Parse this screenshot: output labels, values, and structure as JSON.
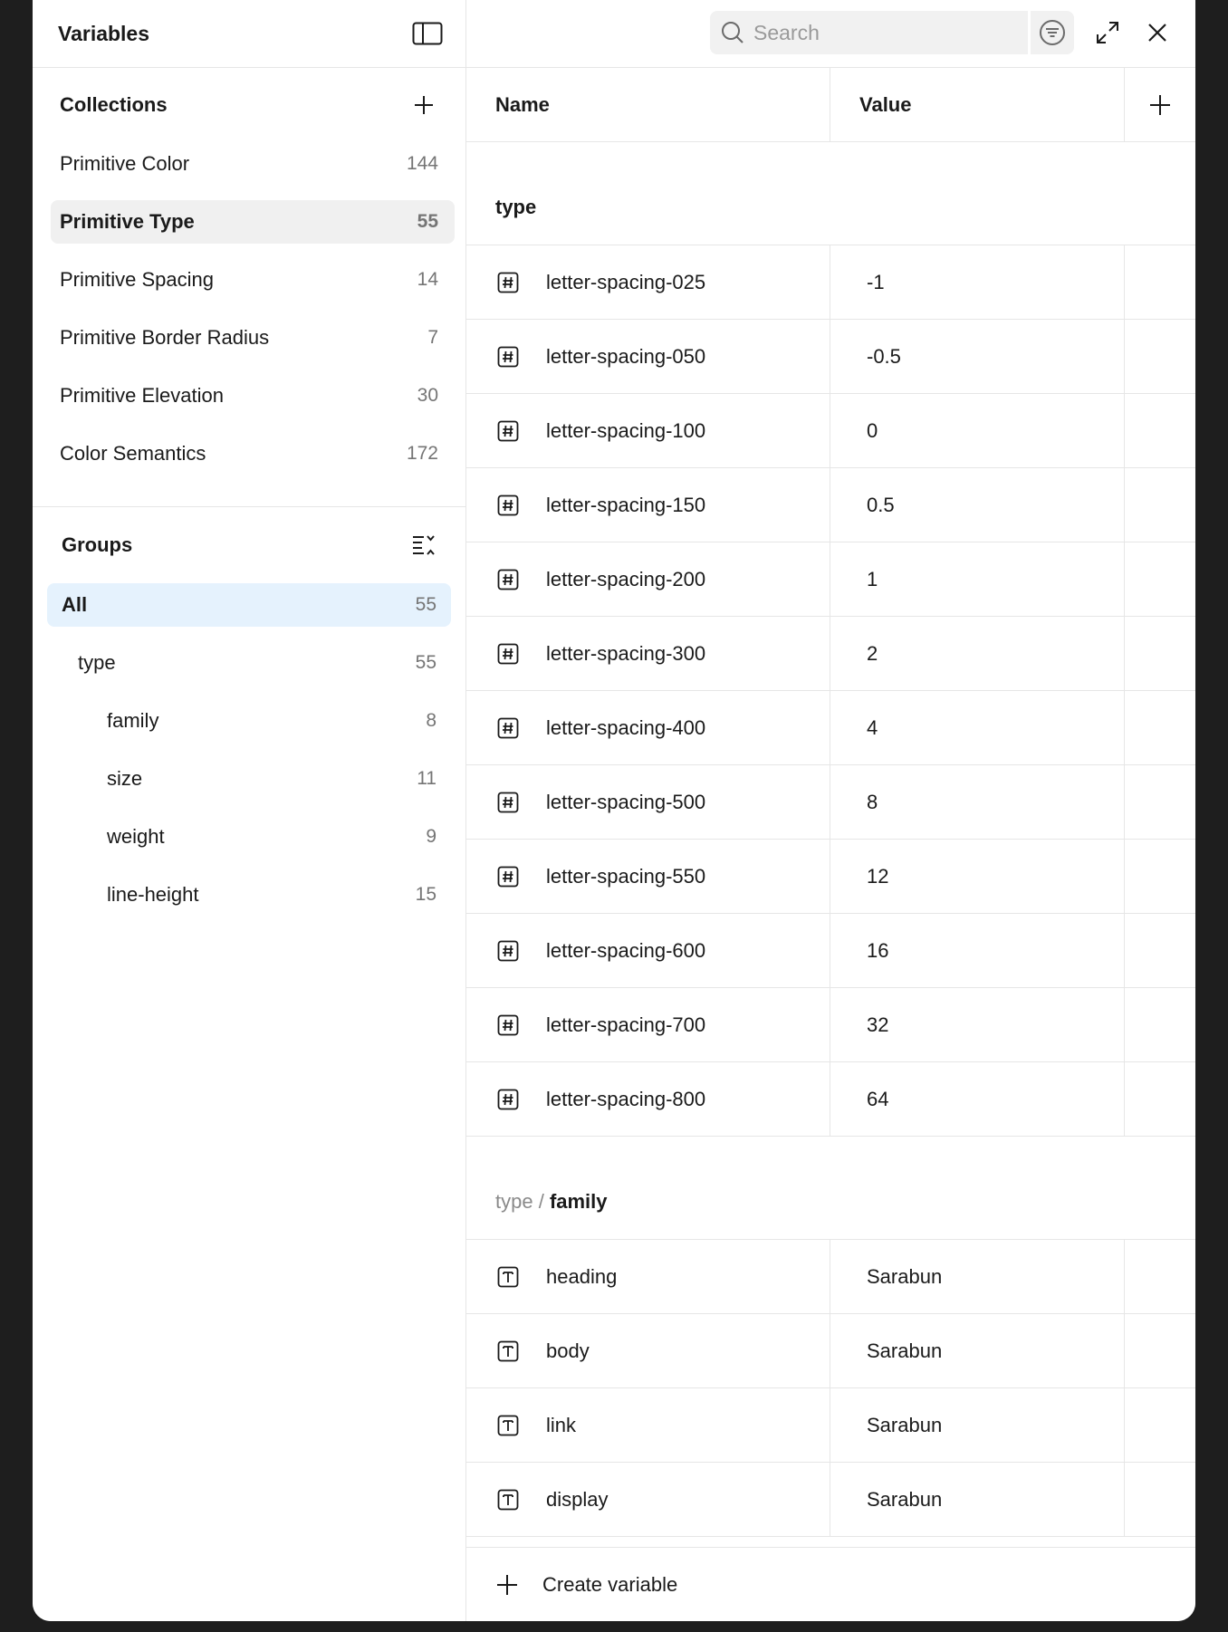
{
  "left": {
    "title": "Variables",
    "collections_label": "Collections",
    "collections": [
      {
        "label": "Primitive Color",
        "count": "144"
      },
      {
        "label": "Primitive Type",
        "count": "55"
      },
      {
        "label": "Primitive Spacing",
        "count": "14"
      },
      {
        "label": "Primitive Border Radius",
        "count": "7"
      },
      {
        "label": "Primitive Elevation",
        "count": "30"
      },
      {
        "label": "Color Semantics",
        "count": "172"
      }
    ],
    "groups_label": "Groups",
    "groups": [
      {
        "label": "All",
        "count": "55"
      },
      {
        "label": "type",
        "count": "55"
      },
      {
        "label": "family",
        "count": "8"
      },
      {
        "label": "size",
        "count": "11"
      },
      {
        "label": "weight",
        "count": "9"
      },
      {
        "label": "line-height",
        "count": "15"
      }
    ]
  },
  "topbar": {
    "search_placeholder": "Search"
  },
  "table": {
    "name_header": "Name",
    "value_header": "Value",
    "group1": {
      "title": "type"
    },
    "group1_rows": [
      {
        "name": "letter-spacing-025",
        "value": "-1"
      },
      {
        "name": "letter-spacing-050",
        "value": "-0.5"
      },
      {
        "name": "letter-spacing-100",
        "value": "0"
      },
      {
        "name": "letter-spacing-150",
        "value": "0.5"
      },
      {
        "name": "letter-spacing-200",
        "value": "1"
      },
      {
        "name": "letter-spacing-300",
        "value": "2"
      },
      {
        "name": "letter-spacing-400",
        "value": "4"
      },
      {
        "name": "letter-spacing-500",
        "value": "8"
      },
      {
        "name": "letter-spacing-550",
        "value": "12"
      },
      {
        "name": "letter-spacing-600",
        "value": "16"
      },
      {
        "name": "letter-spacing-700",
        "value": "32"
      },
      {
        "name": "letter-spacing-800",
        "value": "64"
      }
    ],
    "group2": {
      "path": "type /",
      "title": "family"
    },
    "group2_rows": [
      {
        "name": "heading",
        "value": "Sarabun"
      },
      {
        "name": "body",
        "value": "Sarabun"
      },
      {
        "name": "link",
        "value": "Sarabun"
      },
      {
        "name": "display",
        "value": "Sarabun"
      }
    ]
  },
  "footer": {
    "create_label": "Create variable"
  },
  "colors": {
    "selected_collection_bg": "#f0f0f0",
    "active_group_bg": "#e5f2fd",
    "border": "#e6e6e6"
  }
}
